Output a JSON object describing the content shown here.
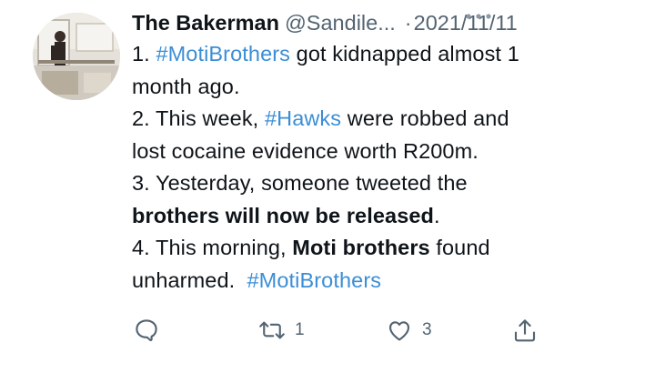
{
  "tweet": {
    "author_name": "The Bakerman",
    "author_handle": "@Sandile...",
    "separator": "·",
    "date": "2021/11/11",
    "lines": [
      {
        "parts": [
          {
            "t": "1. ",
            "k": "text"
          },
          {
            "t": "#MotiBrothers",
            "k": "tag"
          },
          {
            "t": " got kidnapped almost 1",
            "k": "text"
          }
        ]
      },
      {
        "parts": [
          {
            "t": "month ago.",
            "k": "text"
          }
        ]
      },
      {
        "parts": [
          {
            "t": "2. This week, ",
            "k": "text"
          },
          {
            "t": "#Hawks",
            "k": "tag"
          },
          {
            "t": " were robbed and",
            "k": "text"
          }
        ]
      },
      {
        "parts": [
          {
            "t": "lost cocaine evidence worth R200m.",
            "k": "text"
          }
        ]
      },
      {
        "parts": [
          {
            "t": "3. Yesterday, someone tweeted the",
            "k": "text"
          }
        ]
      },
      {
        "parts": [
          {
            "t": "brothers will now be released",
            "k": "bold"
          },
          {
            "t": ".",
            "k": "text"
          }
        ]
      },
      {
        "parts": [
          {
            "t": "4. This morning, ",
            "k": "text"
          },
          {
            "t": "Moti brothers",
            "k": "bold"
          },
          {
            "t": " found",
            "k": "text"
          }
        ]
      },
      {
        "parts": [
          {
            "t": "unharmed.  ",
            "k": "text"
          },
          {
            "t": "#MotiBrothers",
            "k": "tag"
          }
        ]
      }
    ],
    "actions": {
      "reply_icon": "reply-icon",
      "retweet_icon": "retweet-icon",
      "retweet_count": "1",
      "like_icon": "heart-icon",
      "like_count": "3",
      "share_icon": "share-icon"
    }
  },
  "colors": {
    "link": "#3b8ed6",
    "muted": "#536471",
    "text": "#0f1419"
  }
}
